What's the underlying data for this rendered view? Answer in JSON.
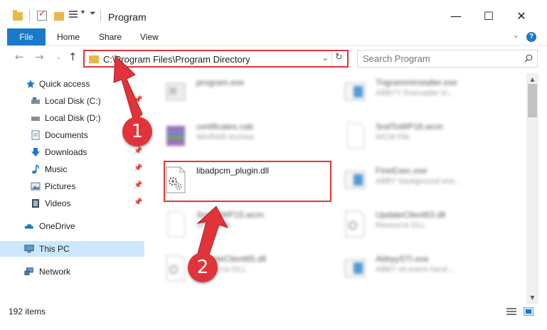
{
  "window": {
    "title": "Program",
    "minimize_icon": "—",
    "maximize_icon": "☐",
    "close_icon": "✕"
  },
  "ribbon": {
    "tabs": [
      {
        "label": "File"
      },
      {
        "label": "Home"
      },
      {
        "label": "Share"
      },
      {
        "label": "View"
      }
    ],
    "help": "?"
  },
  "address": {
    "path": "C:\\Program Files\\Program Directory"
  },
  "search": {
    "placeholder": "Search Program"
  },
  "navpane": {
    "quick_access": "Quick access",
    "items": [
      {
        "label": "Local Disk (C:)"
      },
      {
        "label": "Local Disk (D:)"
      },
      {
        "label": "Documents"
      },
      {
        "label": "Downloads"
      },
      {
        "label": "Music"
      },
      {
        "label": "Pictures"
      },
      {
        "label": "Videos"
      }
    ],
    "onedrive": "OneDrive",
    "this_pc": "This PC",
    "network": "Network"
  },
  "files": {
    "left": [
      {
        "name": "program.exe",
        "desc": ""
      },
      {
        "name": "certificates.cab",
        "desc": "WinRAR Archive"
      },
      {
        "name": "libadpcm_plugin.dll",
        "desc": ""
      },
      {
        "name": "SndToWP15.wcm",
        "desc": "WCM File"
      },
      {
        "name": "UpdateClient65.dll",
        "desc": "Resource DLL"
      }
    ],
    "right": [
      {
        "name": "TrigrammInstaller.exe",
        "desc": "ABBYY fineruader tri..."
      },
      {
        "name": "SndToWP16.wcm",
        "desc": "WCM File"
      },
      {
        "name": "FineExec.exe",
        "desc": "ABBY background exe..."
      },
      {
        "name": "UpdateClient63.dll",
        "desc": "Resource DLL"
      },
      {
        "name": "AbbyySTI.exe",
        "desc": "ABBY sti event hand..."
      }
    ]
  },
  "status": {
    "count": "192 items"
  },
  "markers": {
    "one": "1",
    "two": "2"
  },
  "colors": {
    "accent": "#1979ca",
    "annotation": "#e0343a",
    "selection": "#cce8ff",
    "folder": "#e8b84a"
  }
}
